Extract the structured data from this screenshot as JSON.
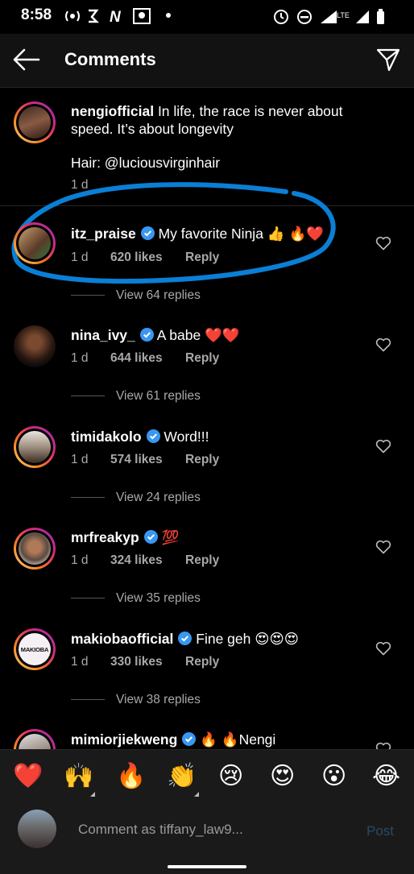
{
  "status": {
    "time": "8:58"
  },
  "header": {
    "title": "Comments"
  },
  "caption": {
    "username": "nengiofficial",
    "text_line1": "In life, the race is never about",
    "text_line2": "speed. It’s about longevity",
    "text_line3": "Hair: @luciousvirginhair",
    "time": "1 d"
  },
  "comments": [
    {
      "username": "itz_praise",
      "text": "My favorite Ninja 👍 🔥❤️",
      "time": "1 d",
      "likes": "620 likes",
      "reply": "Reply",
      "replies": "View 64 replies"
    },
    {
      "username": "nina_ivy_",
      "text": "A babe ❤️❤️",
      "time": "1 d",
      "likes": "644 likes",
      "reply": "Reply",
      "replies": "View 61 replies"
    },
    {
      "username": "timidakolo",
      "text": "Word!!!",
      "time": "1 d",
      "likes": "574 likes",
      "reply": "Reply",
      "replies": "View 24 replies"
    },
    {
      "username": "mrfreakyp",
      "text": "💯",
      "time": "1 d",
      "likes": "324 likes",
      "reply": "Reply",
      "replies": "View 35 replies"
    },
    {
      "username": "makiobaofficial",
      "text": "Fine geh 😍😍😍",
      "time": "1 d",
      "likes": "330 likes",
      "reply": "Reply",
      "replies": "View 38 replies"
    },
    {
      "username": "mimiorjiekweng",
      "text": "🔥 🔥Nengi"
    }
  ],
  "avatar_labels": {
    "makioba": "MAKIOBA"
  },
  "emoji_bar": [
    "❤️",
    "🙌",
    "🔥",
    "👏",
    "😢",
    "😍",
    "😮",
    "😂"
  ],
  "input": {
    "placeholder": "Comment as tiffany_law9...",
    "post": "Post"
  },
  "colors": {
    "verified": "#3897f0",
    "annotation": "#0a7fd6",
    "accent_post": "#2a4a66"
  }
}
